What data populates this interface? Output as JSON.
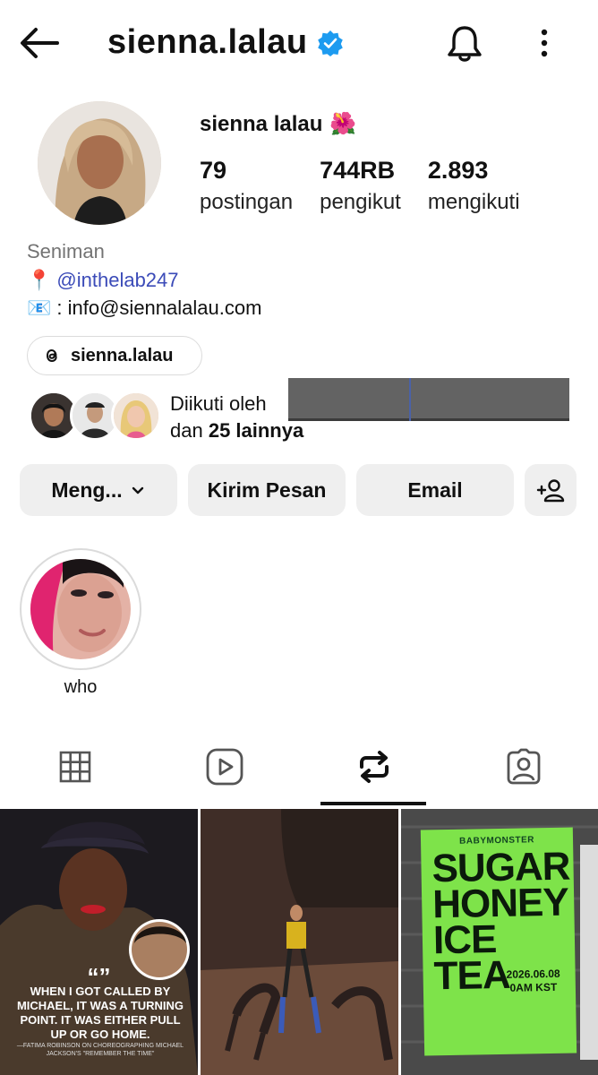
{
  "header": {
    "username": "sienna.lalau",
    "icons": {
      "back": "arrow-left-icon",
      "verified": "verified-badge-icon",
      "notifications": "bell-icon",
      "more": "more-vertical-icon"
    }
  },
  "profile": {
    "display_name": "sienna lalau",
    "name_emoji": "🌺",
    "stats": [
      {
        "value": "79",
        "label": "postingan"
      },
      {
        "value": "744RB",
        "label": "pengikut"
      },
      {
        "value": "2.893",
        "label": "mengikuti"
      }
    ],
    "category": "Seniman",
    "bio": {
      "line1_emoji": "📍",
      "line1_link": "@inthelab247",
      "line2_emoji": "📧",
      "line2_text": ": info@siennalalau.com"
    },
    "threads_handle": "sienna.lalau",
    "followed_by": {
      "prefix": "Diikuti oleh",
      "line2_prefix": "dan ",
      "line2_bold": "25 lainnya"
    }
  },
  "actions": {
    "follow_label": "Meng...",
    "message_label": "Kirim Pesan",
    "email_label": "Email"
  },
  "highlights": [
    {
      "label": "who"
    }
  ],
  "tabs": [
    {
      "name": "grid",
      "icon": "grid-icon"
    },
    {
      "name": "reels",
      "icon": "reels-icon"
    },
    {
      "name": "reposts",
      "icon": "repost-icon",
      "active": true
    },
    {
      "name": "tagged",
      "icon": "tagged-person-icon"
    }
  ],
  "posts": [
    {
      "quote_mark": "“”",
      "quote": "When I got called by Michael, it was a turning point. It was either pull up or go home.",
      "attribution": "—Fatima Robinson on choreographing Michael Jackson's \"Remember the Time\""
    },
    {
      "description_only": true
    },
    {
      "brand": "BABYMONSTER",
      "title": "SUGAR HONEY ICE TEA",
      "date": "2026.06.08",
      "time": "0AM KST"
    }
  ]
}
